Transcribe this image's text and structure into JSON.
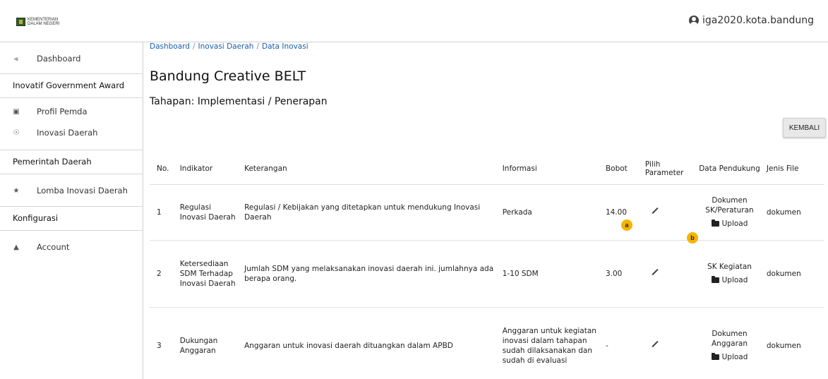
{
  "header": {
    "logo_line1": "KEMENTERIAN",
    "logo_line2": "DALAM NEGERI",
    "user_name": "iga2020.kota.bandung"
  },
  "sidebar": {
    "dashboard": "Dashboard",
    "section_iga": "Inovatif Government Award",
    "profil_pemda": "Profil Pemda",
    "inovasi_daerah": "Inovasi Daerah",
    "section_pemda": "Pemerintah Daerah",
    "lomba": "Lomba Inovasi Daerah",
    "section_konfig": "Konfigurasi",
    "account": "Account"
  },
  "breadcrumb": [
    "Dashboard",
    "Inovasi Daerah",
    "Data Inovasi"
  ],
  "page": {
    "title": "Bandung Creative BELT",
    "subtitle": "Tahapan: Implementasi / Penerapan",
    "back_button": "KEMBALI"
  },
  "table": {
    "headers": {
      "no": "No.",
      "indikator": "Indikator",
      "keterangan": "Keterangan",
      "informasi": "Informasi",
      "bobot": "Bobot",
      "pilih": "Pilih Parameter",
      "data": "Data Pendukung",
      "jenis": "Jenis File"
    },
    "rows": [
      {
        "no": "1",
        "indikator": "Regulasi Inovasi Daerah",
        "keterangan": "Regulasi / Kebijakan yang ditetapkan untuk mendukung Inovasi Daerah",
        "informasi": "Perkada",
        "bobot": "14.00",
        "data_label": "Dokumen SK/Peraturan",
        "upload": "Upload",
        "jenis": "dokumen"
      },
      {
        "no": "2",
        "indikator": "Ketersediaan SDM Terhadap Inovasi Daerah",
        "keterangan": "Jumlah SDM yang melaksanakan inovasi daerah ini. jumlahnya ada berapa orang.",
        "informasi": "1-10 SDM",
        "bobot": "3.00",
        "data_label": "SK Kegiatan",
        "upload": "Upload",
        "jenis": "dokumen"
      },
      {
        "no": "3",
        "indikator": "Dukungan Anggaran",
        "keterangan": "Anggaran untuk inovasi daerah dituangkan dalam APBD",
        "informasi": "Anggaran untuk kegiatan inovasi dalam tahapan sudah dilaksanakan dan sudah di evaluasi",
        "bobot": "-",
        "data_label": "Dokumen Anggaran",
        "upload": "Upload",
        "jenis": "dokumen"
      }
    ]
  },
  "annotations": {
    "a": "a",
    "b": "b"
  },
  "colors": {
    "link": "#1a5da8",
    "badge": "#f4b400"
  }
}
